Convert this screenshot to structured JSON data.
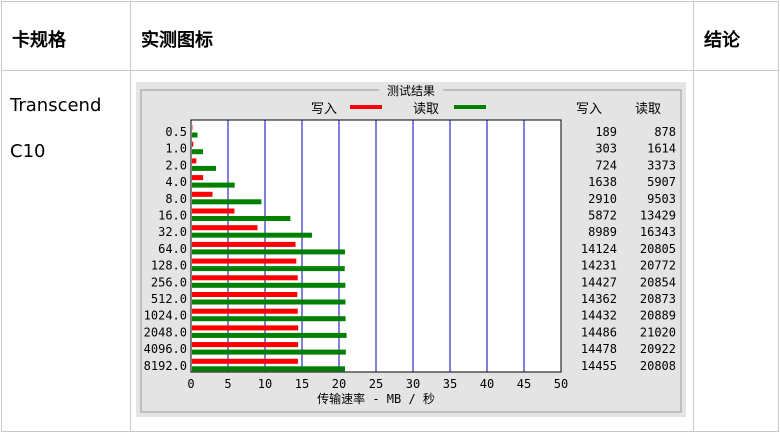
{
  "table": {
    "headers": [
      "卡规格",
      "实测图标",
      "结论"
    ],
    "card_name": "Transcend",
    "card_class": "C10"
  },
  "chart_data": {
    "type": "bar",
    "title": "测试结果",
    "xlabel": "传输速率 - MB / 秒",
    "xlim": [
      0,
      50
    ],
    "xticks": [
      0,
      5,
      10,
      15,
      20,
      25,
      30,
      35,
      40,
      45,
      50
    ],
    "categories": [
      "0.5",
      "1.0",
      "2.0",
      "4.0",
      "8.0",
      "16.0",
      "32.0",
      "64.0",
      "128.0",
      "256.0",
      "512.0",
      "1024.0",
      "2048.0",
      "4096.0",
      "8192.0"
    ],
    "series": [
      {
        "name": "写入",
        "color": "#ff0000",
        "values": [
          189,
          303,
          724,
          1638,
          2910,
          5872,
          8989,
          14124,
          14231,
          14427,
          14362,
          14432,
          14486,
          14478,
          14455
        ]
      },
      {
        "name": "读取",
        "color": "#008000",
        "values": [
          878,
          1614,
          3373,
          5907,
          9503,
          13429,
          16343,
          20805,
          20772,
          20854,
          20873,
          20889,
          21020,
          20922,
          20808
        ]
      }
    ],
    "value_columns": [
      "写入",
      "读取"
    ],
    "grid": true
  }
}
